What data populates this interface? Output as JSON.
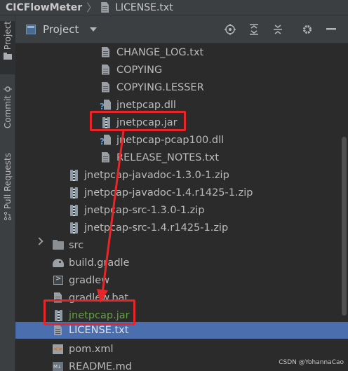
{
  "breadcrumb": {
    "project": "CICFlowMeter",
    "file": "LICENSE.txt"
  },
  "tool_strip": {
    "project_tab": "Project",
    "commit_tab": "Commit",
    "pull_requests_tab": "Pull Requests"
  },
  "panel": {
    "title": "Project",
    "icons": [
      "locate-icon",
      "expand-all-icon",
      "collapse-all-icon",
      "gear-icon",
      "minimize-icon"
    ]
  },
  "tree": {
    "rows": [
      {
        "label": "CHANGE_LOG.txt",
        "icon": "text-file-icon"
      },
      {
        "label": "COPYING",
        "icon": "text-file-icon"
      },
      {
        "label": "COPYING.LESSER",
        "icon": "text-file-icon"
      },
      {
        "label": "jnetpcap.dll",
        "icon": "dll-file-icon"
      },
      {
        "label": "jnetpcap.jar",
        "icon": "jar-file-icon"
      },
      {
        "label": "jnetpcap-pcap100.dll",
        "icon": "dll-file-icon"
      },
      {
        "label": "RELEASE_NOTES.txt",
        "icon": "text-file-icon"
      },
      {
        "label": "jnetpcap-javadoc-1.3.0-1.zip",
        "icon": "zip-file-icon"
      },
      {
        "label": "jnetpcap-javadoc-1.4.r1425-1.zip",
        "icon": "zip-file-icon"
      },
      {
        "label": "jnetpcap-src-1.3.0-1.zip",
        "icon": "zip-file-icon"
      },
      {
        "label": "jnetpcap-src-1.4.r1425-1.zip",
        "icon": "zip-file-icon"
      },
      {
        "label": "src",
        "icon": "folder-icon"
      },
      {
        "label": "build.gradle",
        "icon": "gradle-icon"
      },
      {
        "label": "gradlew",
        "icon": "terminal-file-icon"
      },
      {
        "label": "gradlew.bat",
        "icon": "text-file-icon"
      },
      {
        "label": "jnetpcap.jar",
        "icon": "jar-file-icon"
      },
      {
        "label": "LICENSE.txt",
        "icon": "text-file-icon"
      },
      {
        "label": "pom.xml",
        "icon": "xml-file-icon"
      },
      {
        "label": "README.md",
        "icon": "markdown-file-icon"
      }
    ]
  },
  "colors": {
    "selection": "#4b6eaf",
    "highlight_box": "#e8262a",
    "added_file": "#62a33d",
    "background": "#2b2b2b"
  },
  "watermark": "CSDN @YohannaCao"
}
